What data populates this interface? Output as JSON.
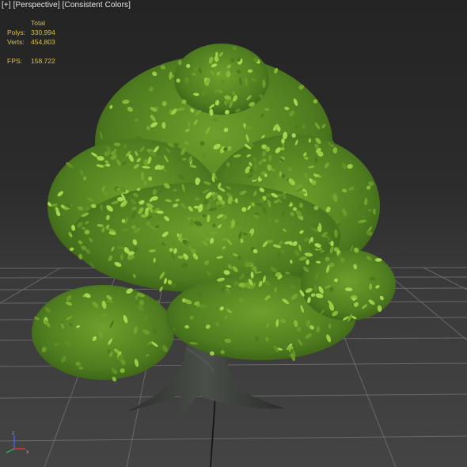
{
  "viewport": {
    "labels": {
      "plus": "[+]",
      "view": "[Perspective]",
      "shading": "[Consistent Colors]"
    },
    "stats": {
      "header": "Total",
      "polys_label": "Polys:",
      "polys_value": "330,994",
      "verts_label": "Verts:",
      "verts_value": "454,803",
      "fps_label": "FPS:",
      "fps_value": "158.722"
    },
    "axis_tripod": {
      "z_label": "z",
      "x_label": "x"
    }
  },
  "colors": {
    "stats_text": "#d8c24a",
    "label_text": "#e6e6e6",
    "grid_line": "#6e6e6e",
    "grid_axis": "#111111",
    "leaf_light": "#8cbf3a",
    "leaf_dark": "#3f6a1a",
    "trunk": "#3c3f3a"
  }
}
